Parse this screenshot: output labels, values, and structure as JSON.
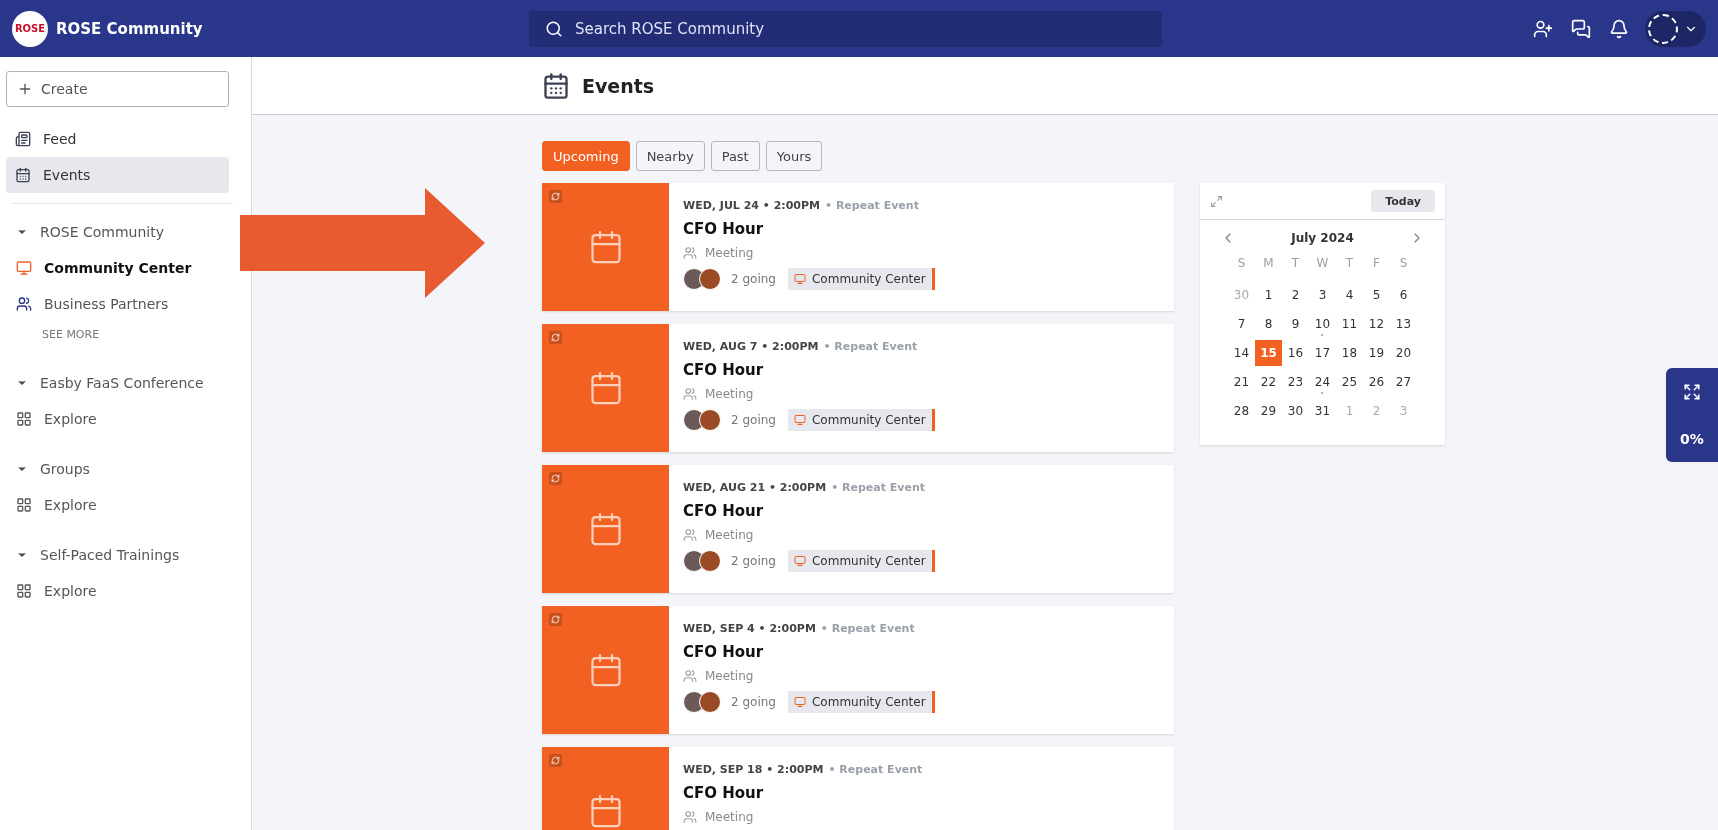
{
  "header": {
    "logo_text": "ROSE",
    "brand": "ROSE Community",
    "search": {
      "placeholder": "Search ROSE Community"
    }
  },
  "sidebar": {
    "create_label": "Create",
    "items": [
      {
        "label": "Feed",
        "kind": "feed",
        "selected": false
      },
      {
        "label": "Events",
        "kind": "calendar",
        "selected": true
      }
    ],
    "sections": [
      {
        "title": "ROSE Community",
        "expanded": true,
        "items": [
          {
            "label": "Community Center",
            "kind": "screen",
            "selected": true
          },
          {
            "label": "Business Partners",
            "kind": "people",
            "selected": false
          }
        ],
        "more": "SEE MORE"
      },
      {
        "title": "Easby FaaS Conference",
        "expanded": true,
        "items": [
          {
            "label": "Explore",
            "kind": "grid",
            "selected": false
          }
        ]
      },
      {
        "title": "Groups",
        "expanded": true,
        "items": [
          {
            "label": "Explore",
            "kind": "grid",
            "selected": false
          }
        ]
      },
      {
        "title": "Self-Paced Trainings",
        "expanded": true,
        "items": [
          {
            "label": "Explore",
            "kind": "grid",
            "selected": false
          }
        ]
      }
    ]
  },
  "page": {
    "title": "Events"
  },
  "tabs": [
    {
      "label": "Upcoming",
      "selected": true
    },
    {
      "label": "Nearby",
      "selected": false
    },
    {
      "label": "Past",
      "selected": false
    },
    {
      "label": "Yours",
      "selected": false
    }
  ],
  "events": [
    {
      "date": "WED, JUL 24 • 2:00PM",
      "repeat": "• Repeat Event",
      "title": "CFO Hour",
      "type": "Meeting",
      "going": "2 going",
      "group": "Community Center"
    },
    {
      "date": "WED, AUG 7 • 2:00PM",
      "repeat": "• Repeat Event",
      "title": "CFO Hour",
      "type": "Meeting",
      "going": "2 going",
      "group": "Community Center"
    },
    {
      "date": "WED, AUG 21 • 2:00PM",
      "repeat": "• Repeat Event",
      "title": "CFO Hour",
      "type": "Meeting",
      "going": "2 going",
      "group": "Community Center"
    },
    {
      "date": "WED, SEP 4 • 2:00PM",
      "repeat": "• Repeat Event",
      "title": "CFO Hour",
      "type": "Meeting",
      "going": "2 going",
      "group": "Community Center"
    },
    {
      "date": "WED, SEP 18 • 2:00PM",
      "repeat": "• Repeat Event",
      "title": "CFO Hour",
      "type": "Meeting"
    }
  ],
  "calendar": {
    "today_label": "Today",
    "month": "July 2024",
    "weekdays": [
      "S",
      "M",
      "T",
      "W",
      "T",
      "F",
      "S"
    ],
    "days": [
      {
        "label": "30",
        "muted": true,
        "selected": false,
        "event": false
      },
      {
        "label": "1",
        "muted": false,
        "selected": false,
        "event": false
      },
      {
        "label": "2",
        "muted": false,
        "selected": false,
        "event": false
      },
      {
        "label": "3",
        "muted": false,
        "selected": false,
        "event": false
      },
      {
        "label": "4",
        "muted": false,
        "selected": false,
        "event": false
      },
      {
        "label": "5",
        "muted": false,
        "selected": false,
        "event": false
      },
      {
        "label": "6",
        "muted": false,
        "selected": false,
        "event": false
      },
      {
        "label": "7",
        "muted": false,
        "selected": false,
        "event": false
      },
      {
        "label": "8",
        "muted": false,
        "selected": false,
        "event": false
      },
      {
        "label": "9",
        "muted": false,
        "selected": false,
        "event": false
      },
      {
        "label": "10",
        "muted": false,
        "selected": false,
        "event": true
      },
      {
        "label": "11",
        "muted": false,
        "selected": false,
        "event": false
      },
      {
        "label": "12",
        "muted": false,
        "selected": false,
        "event": false
      },
      {
        "label": "13",
        "muted": false,
        "selected": false,
        "event": false
      },
      {
        "label": "14",
        "muted": false,
        "selected": false,
        "event": false
      },
      {
        "label": "15",
        "muted": false,
        "selected": true,
        "event": false
      },
      {
        "label": "16",
        "muted": false,
        "selected": false,
        "event": false
      },
      {
        "label": "17",
        "muted": false,
        "selected": false,
        "event": false
      },
      {
        "label": "18",
        "muted": false,
        "selected": false,
        "event": false
      },
      {
        "label": "19",
        "muted": false,
        "selected": false,
        "event": false
      },
      {
        "label": "20",
        "muted": false,
        "selected": false,
        "event": false
      },
      {
        "label": "21",
        "muted": false,
        "selected": false,
        "event": false
      },
      {
        "label": "22",
        "muted": false,
        "selected": false,
        "event": false
      },
      {
        "label": "23",
        "muted": false,
        "selected": false,
        "event": false
      },
      {
        "label": "24",
        "muted": false,
        "selected": false,
        "event": true
      },
      {
        "label": "25",
        "muted": false,
        "selected": false,
        "event": false
      },
      {
        "label": "26",
        "muted": false,
        "selected": false,
        "event": false
      },
      {
        "label": "27",
        "muted": false,
        "selected": false,
        "event": false
      },
      {
        "label": "28",
        "muted": false,
        "selected": false,
        "event": false
      },
      {
        "label": "29",
        "muted": false,
        "selected": false,
        "event": false
      },
      {
        "label": "30",
        "muted": false,
        "selected": false,
        "event": false
      },
      {
        "label": "31",
        "muted": false,
        "selected": false,
        "event": false
      },
      {
        "label": "1",
        "muted": true,
        "selected": false,
        "event": false
      },
      {
        "label": "2",
        "muted": true,
        "selected": false,
        "event": false
      },
      {
        "label": "3",
        "muted": true,
        "selected": false,
        "event": false
      }
    ]
  },
  "progress_widget": {
    "label": "0%"
  }
}
